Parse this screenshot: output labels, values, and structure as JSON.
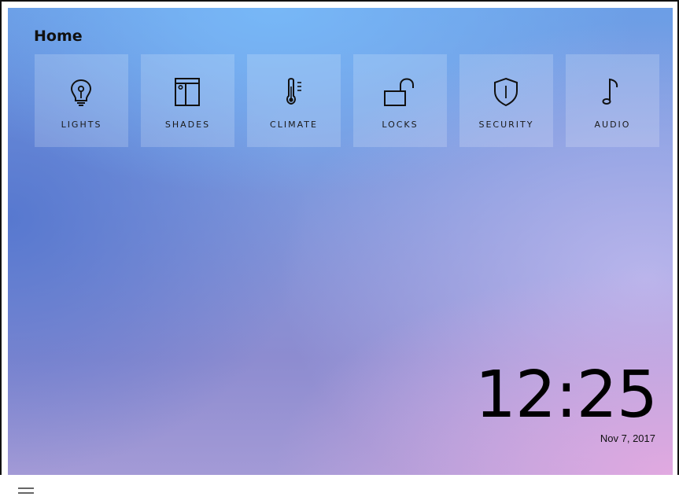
{
  "header": {
    "title": "Home"
  },
  "tiles": [
    {
      "label": "LIGHTS",
      "icon": "lightbulb-icon"
    },
    {
      "label": "SHADES",
      "icon": "window-shade-icon"
    },
    {
      "label": "CLIMATE",
      "icon": "thermometer-icon"
    },
    {
      "label": "LOCKS",
      "icon": "unlocked-padlock-icon"
    },
    {
      "label": "SECURITY",
      "icon": "shield-icon"
    },
    {
      "label": "AUDIO",
      "icon": "music-note-icon"
    }
  ],
  "clock": {
    "time": "12:25",
    "date": "Nov 7, 2017"
  },
  "bottom_bar": {
    "menu_icon": "hamburger-menu-icon"
  }
}
